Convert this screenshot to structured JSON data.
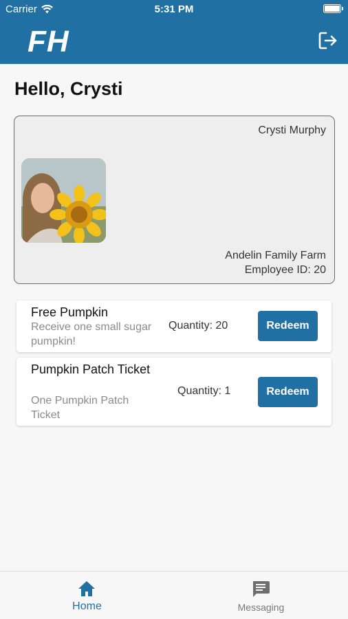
{
  "status_bar": {
    "carrier": "Carrier",
    "time": "5:31 PM"
  },
  "header": {
    "logo": "FH",
    "logout_icon": "logout-icon"
  },
  "greeting": "Hello, Crysti",
  "id_card": {
    "name": "Crysti Murphy",
    "farm": "Andelin Family Farm",
    "employee_id": "Employee ID: 20"
  },
  "rewards": [
    {
      "title": "Free Pumpkin",
      "description": "Receive one small sugar pumpkin!",
      "quantity": "Quantity: 20",
      "button": "Redeem"
    },
    {
      "title": "Pumpkin Patch Ticket",
      "description": "One Pumpkin Patch Ticket",
      "quantity": "Quantity: 1",
      "button": "Redeem"
    }
  ],
  "tabs": [
    {
      "label": "Home",
      "icon": "home-icon"
    },
    {
      "label": "Messaging",
      "icon": "message-icon"
    }
  ],
  "colors": {
    "brand": "#2170a3",
    "background": "#f7f7f7",
    "inactive_tab": "#777777"
  }
}
